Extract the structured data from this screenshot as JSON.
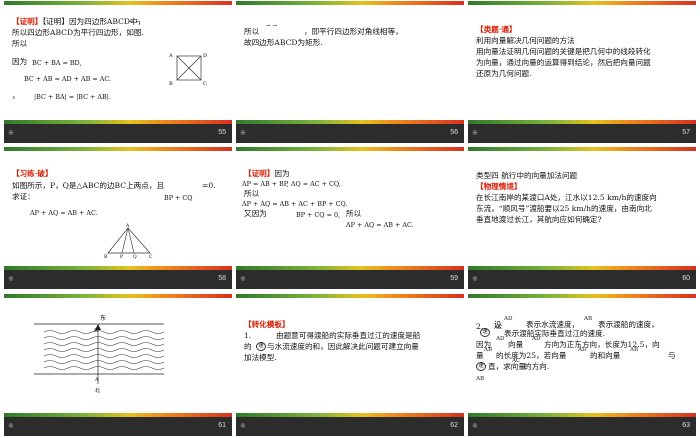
{
  "slides": [
    {
      "number": "55",
      "footer_mark": "※",
      "lines": [
        "【证明】因为四边形ABCD中，",
        "所以四边形ABCD为平行四边形，如图.",
        "所以",
        "因为",
        "，"
      ],
      "formulas": [
        "BC + BA = BD,",
        "BC + AB = AD + AB = AC.",
        "|BC + BA| = |BC + AB|."
      ],
      "figure_labels": [
        "A",
        "B",
        "C",
        "D"
      ]
    },
    {
      "number": "56",
      "footer_mark": "※",
      "lines": [
        "所以",
        "，即平行四边形对角线相等，",
        "故四边形ABCD为矩形."
      ]
    },
    {
      "number": "57",
      "footer_mark": "※",
      "title": "【类题·通】",
      "lines": [
        "利用向量解决几何问题的方法",
        "用向量法证明几何问题的关键是把几何中的线段转化",
        "为向量，通过向量的运算得到结论，然后把向量问题",
        "还原为几何问题."
      ]
    },
    {
      "number": "58",
      "footer_mark": "※",
      "title": "【习练·破】",
      "lines": [
        "如图所示，P，Q是△ABC的边BC上两点，且",
        "=0.",
        "求证："
      ],
      "formulas": [
        "BP + CQ",
        "AP + AQ = AB + AC."
      ],
      "figure_labels": [
        "A",
        "B",
        "P",
        "Q",
        "C"
      ]
    },
    {
      "number": "59",
      "footer_mark": "※",
      "title": "【证明】",
      "lines": [
        "因为",
        "所以",
        "又因为",
        "所以"
      ],
      "formulas": [
        "AP = AB + BP, AQ = AC + CQ,",
        "AP + AQ = AB + AC + BP + CQ.",
        "BP + CQ = 0,",
        "AP + AQ = AB + AC."
      ]
    },
    {
      "number": "60",
      "footer_mark": "※",
      "heading": "类型四  航行中的向量加法问题",
      "title": "【物理情境】",
      "lines": [
        "在长江南岸的某渡口A处，江水以12.5 km/h的速度向",
        "东流，“顺风号”渡船要以25 km/h的速度，由南向北",
        "垂直地渡过长江，其航向应如何确定?"
      ]
    },
    {
      "number": "61",
      "footer_mark": "※",
      "figure_labels": [
        "东",
        "B",
        "A",
        "北"
      ]
    },
    {
      "number": "62",
      "footer_mark": "※",
      "title": "【转化模板】",
      "lines": [
        "1.",
        "由题意可得渡船的实际垂直过江的速度是船",
        "的",
        "与水流速度的和，因此解决此问题可建立向量",
        "加法模型."
      ],
      "circle": "速"
    },
    {
      "number": "63",
      "footer_mark": "※",
      "lines": [
        "2.",
        "设",
        "表示水流速度，",
        "表示渡船的速度，",
        "表示渡船实际垂直过江的速度.",
        "因为",
        "向量",
        "方向为正东方向，长度为12.5，向",
        "量",
        "的长度为25，若向量",
        "的和向量",
        "与",
        "直，求向量",
        "的方向."
      ],
      "formulas": [
        "AD",
        "AB",
        "AC",
        "AD",
        "AD",
        "AB",
        "AD",
        "AB",
        "AC",
        "AB"
      ],
      "circles": [
        "速",
        "速"
      ]
    }
  ]
}
